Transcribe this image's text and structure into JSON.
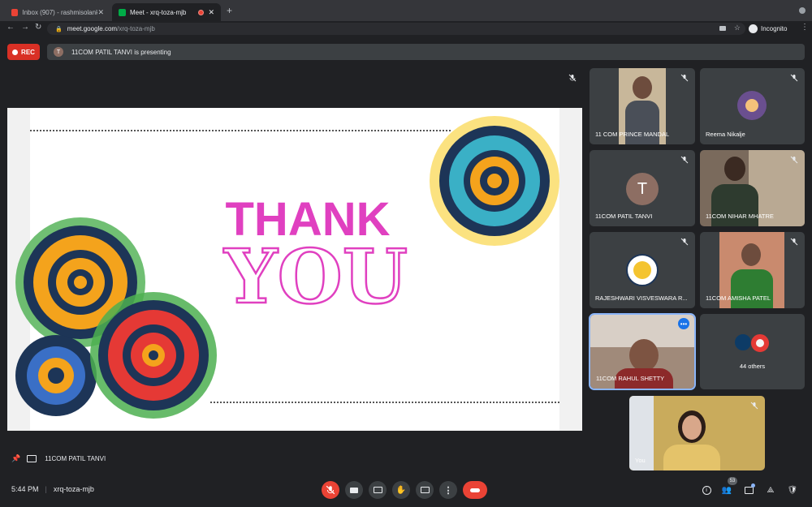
{
  "browser": {
    "tabs": [
      {
        "title": "Inbox (907) - rashmisolanki@",
        "favicon_color": "#ea4335"
      },
      {
        "title": "Meet - xrq-toza-mjb",
        "favicon_color": "#00ac47"
      }
    ],
    "url_host": "meet.google.com",
    "url_path": "/xrq-toza-mjb",
    "incognito_label": "Incognito"
  },
  "meet": {
    "rec_label": "REC",
    "presenter_initial": "T",
    "presenting_text": "11COM PATIL TANVI is presenting",
    "pinned_presenter": "11COM PATIL TANVI",
    "time": "5:44 PM",
    "meeting_code": "xrq-toza-mjb",
    "participant_count": "53"
  },
  "slide": {
    "line1": "THANK",
    "line2": "YOU",
    "accent": "#e040c0"
  },
  "participants": [
    {
      "name": "11 COM PRINCE MANDAL"
    },
    {
      "name": "Reema Nikalje"
    },
    {
      "name": "11COM PATIL TANVI",
      "initial": "T"
    },
    {
      "name": "11COM NIHAR MHATRE"
    },
    {
      "name": "RAJESHWARI VISVESWARA R..."
    },
    {
      "name": "11COM AMISHA PATEL"
    },
    {
      "name": "11COM RAHUL SHETTY"
    },
    {
      "name": "44 others"
    },
    {
      "name": "You"
    }
  ],
  "colors": {
    "end_call": "#ea4335",
    "active_outline": "#8ab4f8"
  }
}
